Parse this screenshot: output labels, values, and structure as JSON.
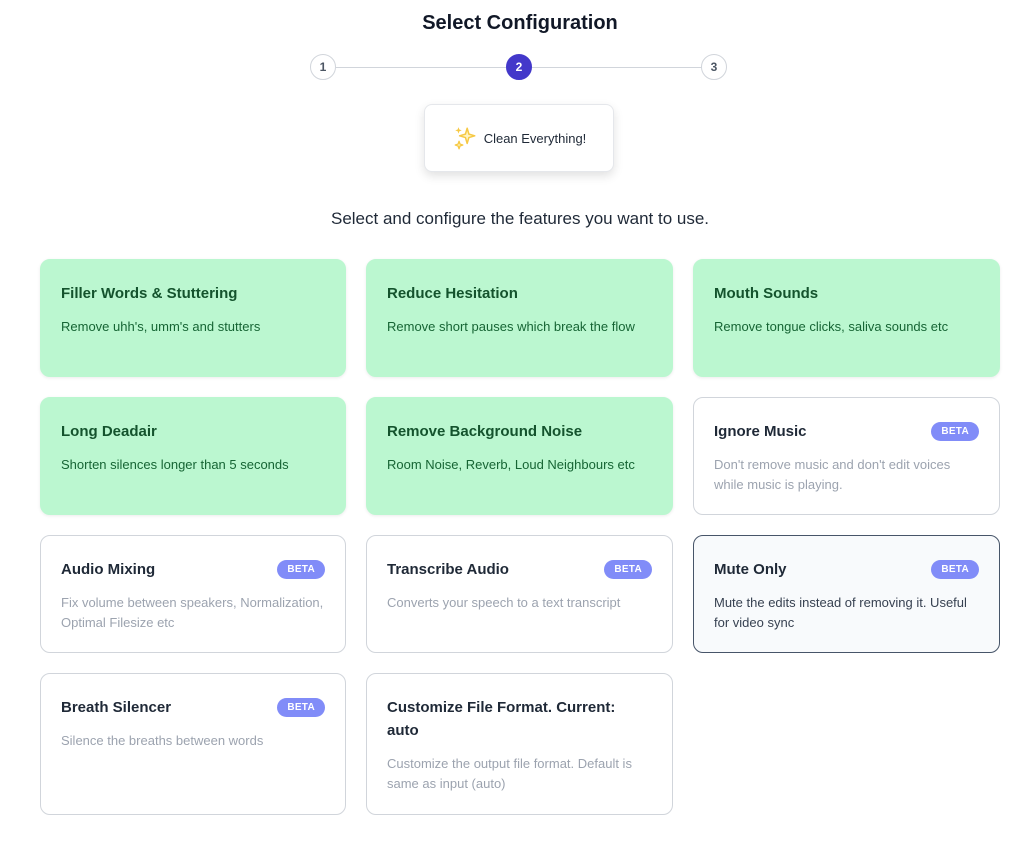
{
  "header": {
    "title": "Select Configuration"
  },
  "stepper": {
    "steps": [
      {
        "label": "1",
        "active": false
      },
      {
        "label": "2",
        "active": true
      },
      {
        "label": "3",
        "active": false
      }
    ]
  },
  "clean_button": {
    "label": "Clean Everything!",
    "icon": "sparkles-icon"
  },
  "subtitle": "Select and configure the features you want to use.",
  "badge_label": "BETA",
  "colors": {
    "selected_card": "#bbf7d0",
    "active_step": "#4338ca",
    "beta_badge": "#818cf8",
    "sparkle": "#f6c945"
  },
  "features": [
    {
      "title": "Filler Words & Stuttering",
      "description": "Remove uhh's, umm's and stutters",
      "selected": true,
      "beta": false
    },
    {
      "title": "Reduce Hesitation",
      "description": "Remove short pauses which break the flow",
      "selected": true,
      "beta": false
    },
    {
      "title": "Mouth Sounds",
      "description": "Remove tongue clicks, saliva sounds etc",
      "selected": true,
      "beta": false
    },
    {
      "title": "Long Deadair",
      "description": "Shorten silences longer than 5 seconds",
      "selected": true,
      "beta": false
    },
    {
      "title": "Remove Background Noise",
      "description": "Room Noise, Reverb, Loud Neighbours etc",
      "selected": true,
      "beta": false
    },
    {
      "title": "Ignore Music",
      "description": "Don't remove music and don't edit voices while music is playing.",
      "selected": false,
      "beta": true
    },
    {
      "title": "Audio Mixing",
      "description": "Fix volume between speakers, Normalization, Optimal Filesize etc",
      "selected": false,
      "beta": true
    },
    {
      "title": "Transcribe Audio",
      "description": "Converts your speech to a text transcript",
      "selected": false,
      "beta": true
    },
    {
      "title": "Mute Only",
      "description": "Mute the edits instead of removing it. Useful for video sync",
      "selected": false,
      "beta": true,
      "focused": true
    },
    {
      "title": "Breath Silencer",
      "description": "Silence the breaths between words",
      "selected": false,
      "beta": true
    },
    {
      "title": "Customize File Format. Current: auto",
      "description": "Customize the output file format. Default is same as input (auto)",
      "selected": false,
      "beta": false
    }
  ]
}
